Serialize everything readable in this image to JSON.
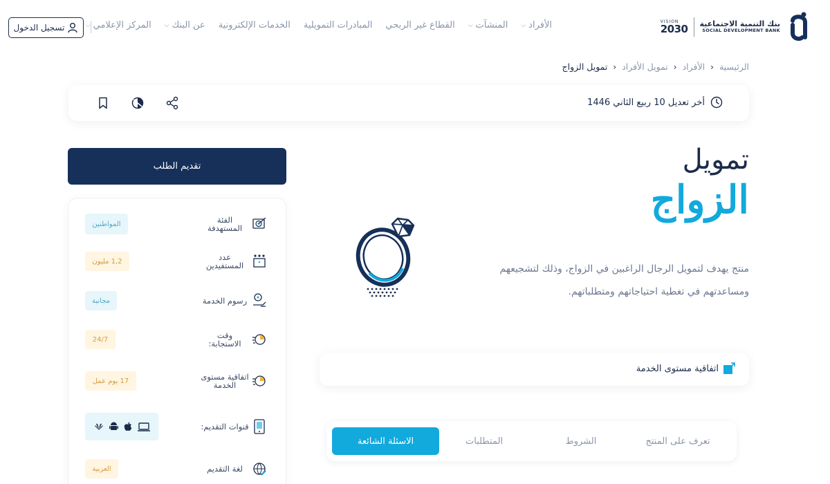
{
  "header": {
    "bank_name_ar": "بنك التنمية الاجتماعية",
    "bank_name_en": "SOCIAL DEVELOPMENT BANK",
    "vision_label": "VISION",
    "vision_year": "2030",
    "nav": [
      {
        "label": "الأفراد",
        "has_dropdown": true
      },
      {
        "label": "المنشآت",
        "has_dropdown": true
      },
      {
        "label": "القطاع غير الربحي",
        "has_dropdown": false
      },
      {
        "label": "المبادرات التمويلية",
        "has_dropdown": false
      },
      {
        "label": "الخدمات الإلكترونية",
        "has_dropdown": false
      },
      {
        "label": "عن البنك",
        "has_dropdown": true
      },
      {
        "label": "المركز الإعلامي",
        "has_dropdown": true
      }
    ],
    "login_label": "تسجيل الدخول"
  },
  "breadcrumb": [
    "الرئيسية",
    "الأفراد",
    "تمويل الأفراد",
    "تمويل الزواج"
  ],
  "info_bar": {
    "last_updated": "أخر تعديل 10 ربيع الثاني 1446"
  },
  "sidebar": {
    "apply_label": "تقديم الطلب",
    "rows": [
      {
        "label": "الفئة المستهدفة",
        "value": "المواطنين",
        "style": "blue",
        "icon": "target-audience-icon"
      },
      {
        "label": "عدد المستفيدين",
        "value": "1,2 مليون",
        "style": "orange",
        "icon": "beneficiaries-icon"
      },
      {
        "label": "رسوم الخدمة",
        "value": "مجانية",
        "style": "blue",
        "icon": "service-fee-icon"
      },
      {
        "label": "وقت الاستجابة:",
        "value": "24/7",
        "style": "orange",
        "icon": "response-time-icon"
      },
      {
        "label": "اتفاقية مستوى الخدمة",
        "value": "17 يوم عمل",
        "style": "orange",
        "icon": "sla-clock-icon"
      },
      {
        "label": "قنوات التقديم:",
        "value": "",
        "style": "blue",
        "icon": "channels-icon"
      },
      {
        "label": "لغة التقديم",
        "value": "العربية",
        "style": "orange",
        "icon": "language-icon"
      }
    ]
  },
  "main": {
    "title_line1": "تمويل",
    "title_line2": "الزواج",
    "description": "منتج يهدف لتمويل الرجال الراغبين في الزواج، وذلك لتشجيعهم ومساعدتهم في تغطية احتياجاتهم ومتطلباتهم.",
    "sla_label": "اتفاقية مستوى الخدمة",
    "tabs": [
      {
        "label": "تعرف على المنتج",
        "active": false
      },
      {
        "label": "الشروط",
        "active": false
      },
      {
        "label": "المتطلبات",
        "active": false
      },
      {
        "label": "الاسئلة الشائعة",
        "active": true
      }
    ]
  },
  "colors": {
    "navy": "#16305a",
    "accent": "#12a9dd",
    "muted": "#8a96aa"
  }
}
